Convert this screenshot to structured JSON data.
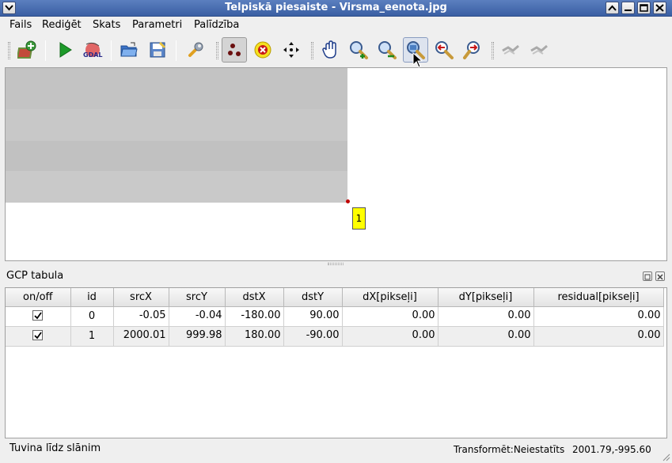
{
  "window": {
    "title": "Telpiskā piesaiste - Virsma_eenota.jpg"
  },
  "menu": [
    "Fails",
    "Rediģēt",
    "Skats",
    "Parametri",
    "Palīdzība"
  ],
  "toolbar": {
    "icons": [
      "open-raster-icon",
      "start-georeferencing-icon",
      "gdal-script-icon",
      "load-gcp-icon",
      "save-gcp-icon",
      "settings-icon",
      "add-point-icon",
      "delete-point-icon",
      "move-point-icon",
      "pan-icon",
      "zoom-in-icon",
      "zoom-out-icon",
      "zoom-to-layer-icon",
      "zoom-last-icon",
      "zoom-next-icon",
      "link-georeferencer-icon",
      "link-qgis-icon"
    ],
    "active_tool": "add-point-icon"
  },
  "canvas": {
    "gcp_label": "1",
    "gcp_point_color": "#c00000",
    "gcp_label_color": "#ffff00"
  },
  "dock": {
    "title": "GCP tabula"
  },
  "table": {
    "headers": [
      "on/off",
      "id",
      "srcX",
      "srcY",
      "dstX",
      "dstY",
      "dX[pikseļi]",
      "dY[pikseļi]",
      "residual[pikseļi]"
    ],
    "rows": [
      {
        "enabled": true,
        "id": "0",
        "srcX": "-0.05",
        "srcY": "-0.04",
        "dstX": "-180.00",
        "dstY": "90.00",
        "dX": "0.00",
        "dY": "0.00",
        "residual": "0.00"
      },
      {
        "enabled": true,
        "id": "1",
        "srcX": "2000.01",
        "srcY": "999.98",
        "dstX": "180.00",
        "dstY": "-90.00",
        "dX": "0.00",
        "dY": "0.00",
        "residual": "0.00"
      }
    ]
  },
  "status": {
    "left": "Tuvina līdz slānim",
    "transform": "Transformēt:Neiestatīts",
    "coords": "2001.79,-995.60"
  }
}
